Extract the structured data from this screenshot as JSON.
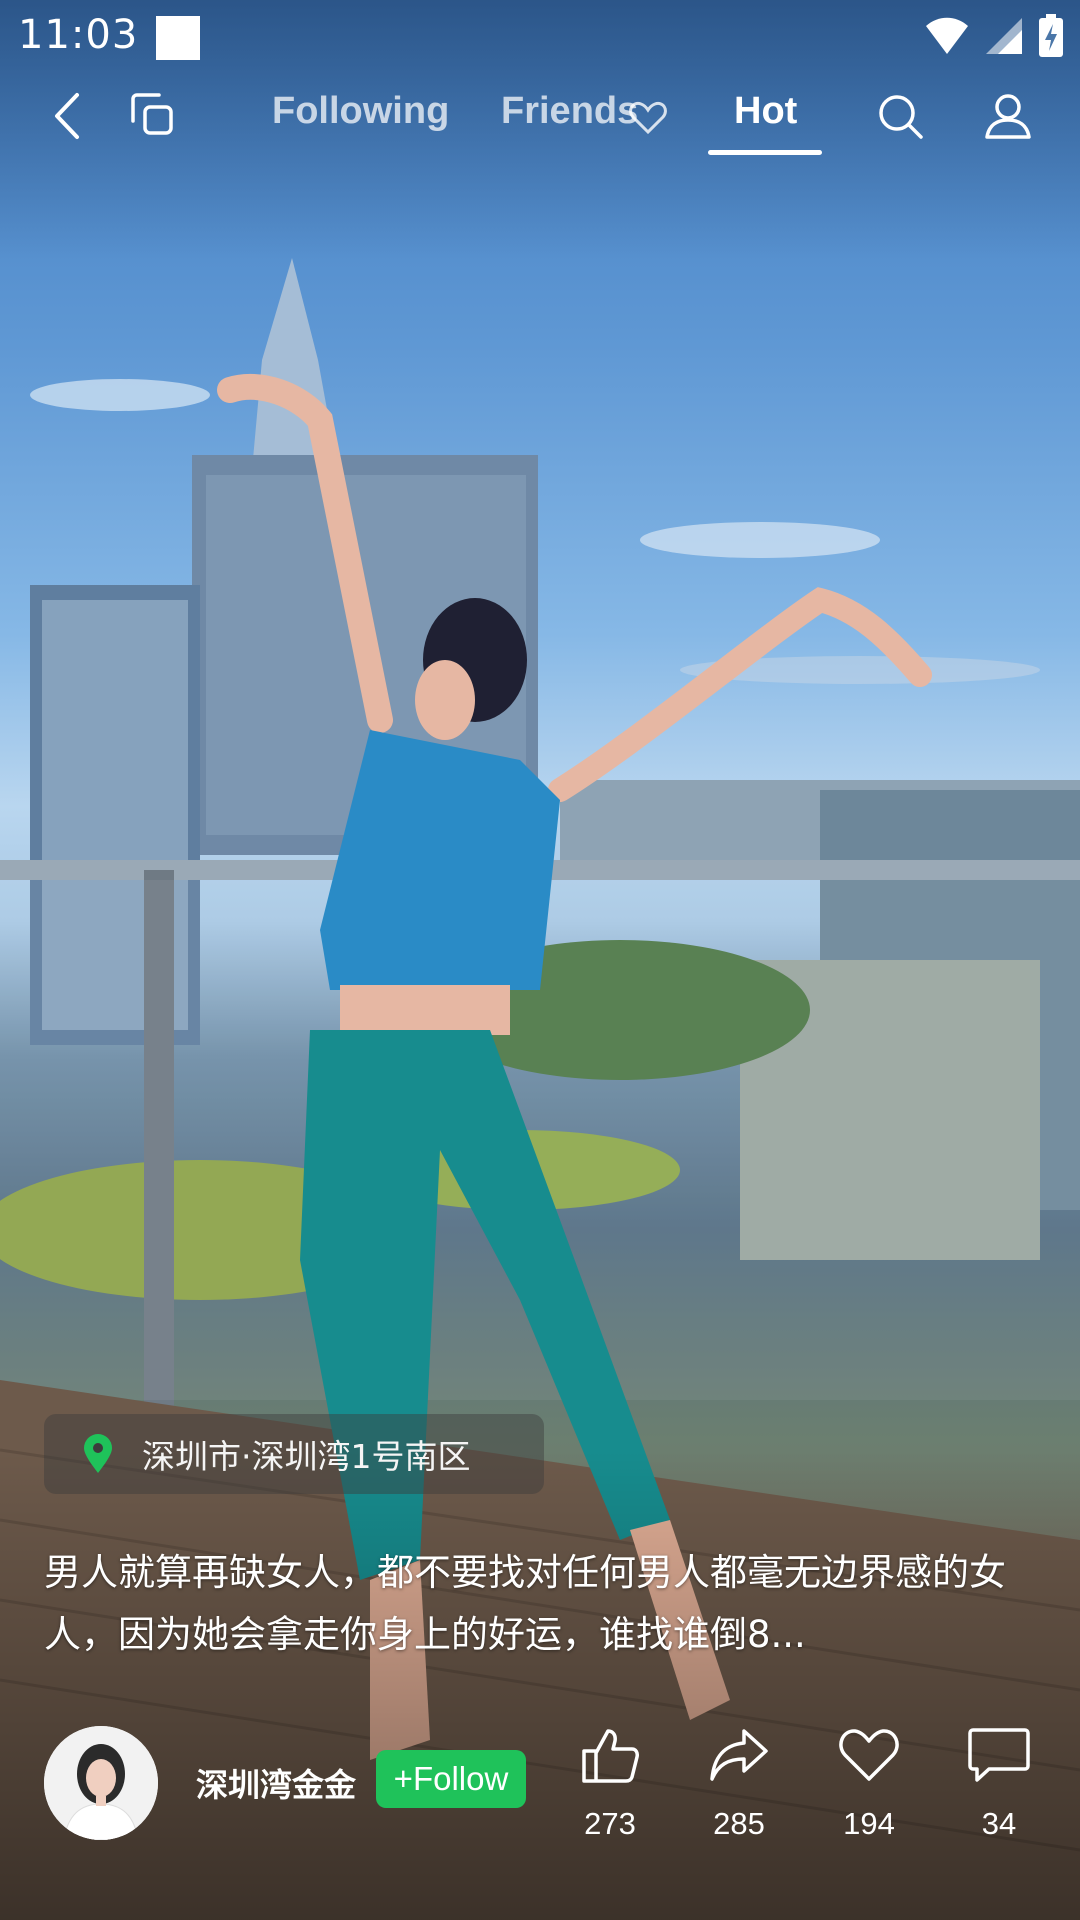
{
  "status_bar": {
    "time": "11:03"
  },
  "nav": {
    "tabs": [
      {
        "label": "Following",
        "active": false
      },
      {
        "label": "Friends",
        "active": false
      },
      {
        "label": "Hot",
        "active": true
      }
    ]
  },
  "video": {
    "location": "深圳市·深圳湾1号南区",
    "caption": "男人就算再缺女人，都不要找对任何男人都毫无边界感的女人，因为她会拿走你身上的好运，谁找谁倒8..."
  },
  "author": {
    "username": "深圳湾金金",
    "follow_label": "+Follow"
  },
  "actions": {
    "like": {
      "count": "273",
      "icon": "thumbs-up-icon"
    },
    "share": {
      "count": "285",
      "icon": "share-arrow-icon"
    },
    "favorite": {
      "count": "194",
      "icon": "heart-icon"
    },
    "comment": {
      "count": "34",
      "icon": "comment-bubble-icon"
    }
  },
  "colors": {
    "follow_button": "#1fc25a",
    "location_pin": "#1fc25a"
  }
}
